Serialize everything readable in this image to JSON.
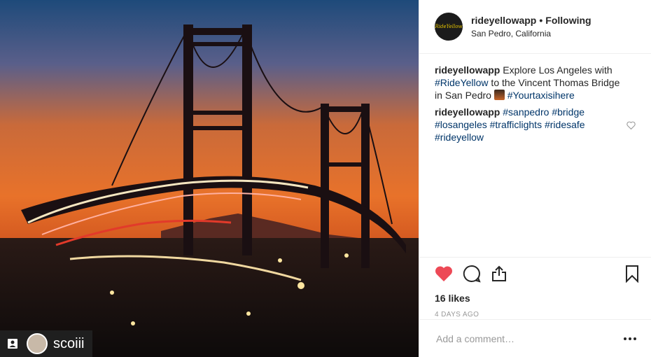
{
  "post": {
    "username": "rideyellowapp",
    "follow_status": "Following",
    "separator": "•",
    "location": "San Pedro, California",
    "avatar_text": "RideYellow"
  },
  "media": {
    "description": "Vincent Thomas Bridge at sunset with light trails",
    "repost_user": "scoiii"
  },
  "comments": [
    {
      "user": "rideyellowapp",
      "parts": [
        " Explore Los Angeles with ",
        "#RideYellow",
        " to the Vincent Thomas Bridge in San Pedro ",
        "#Yourtaxisihere"
      ]
    },
    {
      "user": "rideyellowapp",
      "tags": [
        "#sanpedro",
        "#bridge",
        "#losangeles",
        "#trafficlights",
        "#ridesafe",
        "#rideyellow"
      ]
    }
  ],
  "stats": {
    "likes": "16 likes",
    "timestamp": "4 DAYS AGO"
  },
  "comment_box": {
    "placeholder": "Add a comment…"
  },
  "colors": {
    "like_red": "#ed4956",
    "hashtag": "#003569"
  },
  "icons": [
    "heart-icon",
    "comment-icon",
    "share-icon",
    "bookmark-icon",
    "more-icon",
    "user-tag-icon"
  ]
}
